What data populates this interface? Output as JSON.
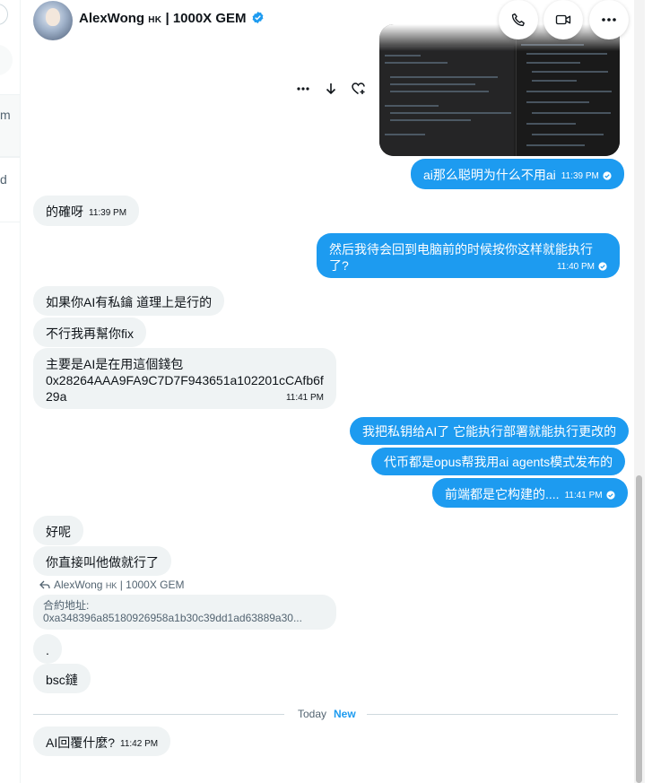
{
  "header": {
    "display_name": "AlexWong",
    "region_tag": "HK",
    "name_suffix": "| 1000X GEM",
    "verified": true,
    "actions": [
      "phone-icon",
      "video-icon",
      "more-icon"
    ]
  },
  "sidebar": {
    "fragments": [
      "m",
      "d"
    ]
  },
  "message_actions": [
    "more-icon",
    "download-icon",
    "react-icon"
  ],
  "messages": [
    {
      "side": "out",
      "text": "ai那么聪明为什么不用ai",
      "time": "11:39 PM",
      "read": true
    },
    {
      "side": "in",
      "text": "的確呀",
      "time": "11:39 PM"
    },
    {
      "side": "out",
      "line1": "然后我待会回到电脑前的时候按你这样就能执行",
      "line2": "了?",
      "time": "11:40 PM",
      "read": true
    },
    {
      "side": "in",
      "text": "如果你AI有私鑰 道理上是行的"
    },
    {
      "side": "in",
      "text": "不行我再幫你fix"
    },
    {
      "side": "in",
      "line1": "主要是AI是在用這個錢包",
      "line2": "0x28264AAA9FA9C7D7F943651a102201cCAfb6f",
      "line3": "29a",
      "time": "11:41 PM"
    },
    {
      "side": "out",
      "text": "我把私钥给AI了 它能执行部署就能执行更改的"
    },
    {
      "side": "out",
      "text": "代币都是opus帮我用ai agents模式发布的"
    },
    {
      "side": "out",
      "text": "前端都是它构建的....",
      "time": "11:41 PM",
      "read": true
    },
    {
      "side": "in",
      "text": "好呢"
    },
    {
      "side": "in",
      "text": "你直接叫他做就行了"
    },
    {
      "side": "in",
      "text": "."
    },
    {
      "side": "in",
      "text": "bsc鏈"
    },
    {
      "side": "in",
      "text": "AI回覆什麼?",
      "time": "11:42 PM"
    }
  ],
  "reply": {
    "name": "AlexWong",
    "region_tag": "HK",
    "suffix": "| 1000X GEM",
    "quote_line1": "合約地址:",
    "quote_line2": "0xa348396a85180926958a1b30c39dd1ad63889a30..."
  },
  "divider": {
    "label": "Today",
    "badge": "New"
  },
  "colors": {
    "accent": "#1d9bf0",
    "incoming_bg": "#eff3f4",
    "text": "#0f1419",
    "muted": "#536471"
  }
}
